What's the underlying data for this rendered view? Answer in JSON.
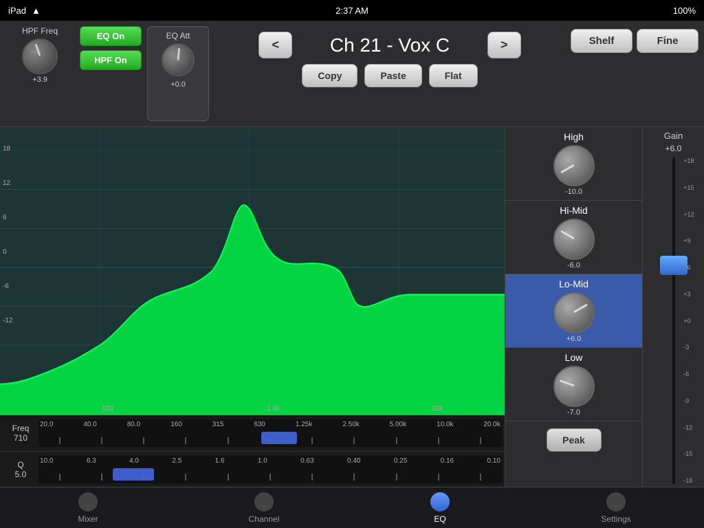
{
  "statusBar": {
    "device": "iPad",
    "wifi": "wifi",
    "time": "2:37 AM",
    "battery": "100%"
  },
  "topControls": {
    "hpfFreq": {
      "label": "HPF Freq",
      "value": "+3.9"
    },
    "eqOnBtn": "EQ On",
    "hpfOnBtn": "HPF On",
    "eqAtt": {
      "label": "EQ Att",
      "value": "+0.0"
    },
    "navPrev": "<",
    "channelTitle": "Ch 21 - Vox C",
    "navNext": ">",
    "shelfBtn": "Shelf",
    "fineBtn": "Fine",
    "copyBtn": "Copy",
    "pasteBtn": "Paste",
    "flatBtn": "Flat"
  },
  "eqGraph": {
    "yLabels": [
      "18",
      "12",
      "6",
      "0",
      "-6",
      "-12"
    ],
    "xLabels": [
      "100",
      "1.0k",
      "10k"
    ]
  },
  "freqSlider": {
    "label": "Freq",
    "value": "710",
    "marks": [
      "20.0",
      "40.0",
      "80.0",
      "160",
      "315",
      "630",
      "1.25k",
      "2.50k",
      "5.00k",
      "10.0k",
      "20.0k"
    ]
  },
  "qSlider": {
    "label": "Q",
    "value": "5.0",
    "marks": [
      "10.0",
      "6.3",
      "4.0",
      "2.5",
      "1.6",
      "1.0",
      "0.63",
      "0.40",
      "0.25",
      "0.16",
      "0.10"
    ]
  },
  "rightPanel": {
    "bands": [
      {
        "id": "high",
        "label": "High",
        "value": "-10.0",
        "active": false,
        "knobAngle": -120
      },
      {
        "id": "hi-mid",
        "label": "Hi-Mid",
        "value": "-6.0",
        "active": false,
        "knobAngle": -60
      },
      {
        "id": "lo-mid",
        "label": "Lo-Mid",
        "value": "+6.0",
        "active": true,
        "knobAngle": 60
      },
      {
        "id": "low",
        "label": "Low",
        "value": "-7.0",
        "active": false,
        "knobAngle": -70
      }
    ],
    "peakBtn": "Peak"
  },
  "gainFader": {
    "label": "Gain",
    "value": "+6.0",
    "marks": [
      "+18",
      "+15",
      "+12",
      "+9",
      "+6",
      "+3",
      "+0",
      "-3",
      "-6",
      "-9",
      "-12",
      "-15",
      "-18"
    ]
  },
  "bottomNav": {
    "items": [
      {
        "id": "mixer",
        "label": "Mixer",
        "active": false
      },
      {
        "id": "channel",
        "label": "Channel",
        "active": false
      },
      {
        "id": "eq",
        "label": "EQ",
        "active": true
      },
      {
        "id": "settings",
        "label": "Settings",
        "active": false
      }
    ]
  }
}
